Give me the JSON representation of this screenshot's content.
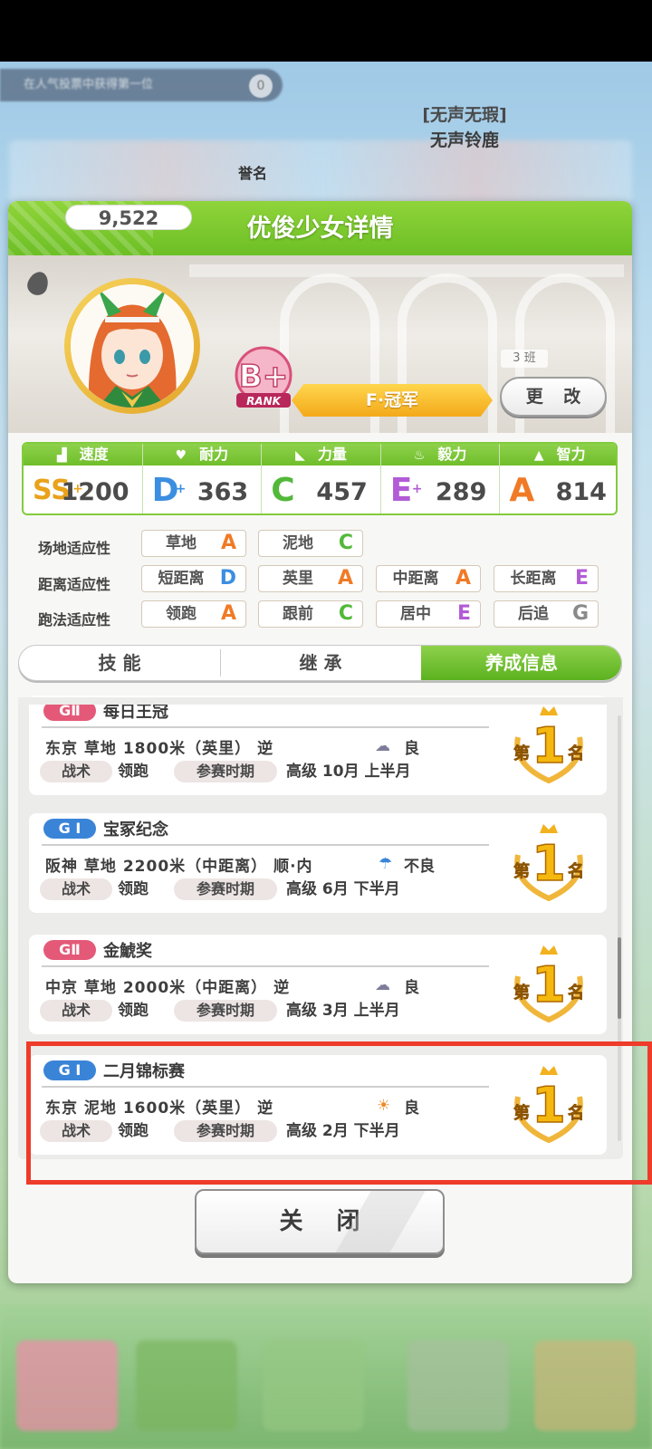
{
  "background": {
    "banner_text": "在人气投票中获得第一位",
    "banner_badge": "0"
  },
  "dialog": {
    "title": "优俊少女详情",
    "profile": {
      "score": "9,522",
      "rank_grade": "B+",
      "rank_label": "RANK",
      "rank_caption": "誉名",
      "epithet": "[无声无瑕]",
      "name": "无声铃鹿",
      "class_tag": "3 班",
      "title": "F·冠军",
      "change_button": "更 改"
    },
    "stats": [
      {
        "label": "速度",
        "icon": "shoe-icon",
        "grade": "SS",
        "grade_plus": "+",
        "value": "1200",
        "color": "#e9a21a"
      },
      {
        "label": "耐力",
        "icon": "heart-icon",
        "grade": "D",
        "grade_plus": "+",
        "value": "363",
        "color": "#3b8ee0"
      },
      {
        "label": "力量",
        "icon": "muscle-icon",
        "grade": "C",
        "grade_plus": "",
        "value": "457",
        "color": "#52b83a"
      },
      {
        "label": "毅力",
        "icon": "flame-icon",
        "grade": "E",
        "grade_plus": "+",
        "value": "289",
        "color": "#b35bd6"
      },
      {
        "label": "智力",
        "icon": "graduation-cap-icon",
        "grade": "A",
        "grade_plus": "",
        "value": "814",
        "color": "#f07a26"
      }
    ],
    "aptitude": {
      "track": {
        "label": "场地适应性",
        "items": [
          {
            "name": "草地",
            "grade": "A"
          },
          {
            "name": "泥地",
            "grade": "C"
          }
        ]
      },
      "distance": {
        "label": "距离适应性",
        "items": [
          {
            "name": "短距离",
            "grade": "D"
          },
          {
            "name": "英里",
            "grade": "A"
          },
          {
            "name": "中距离",
            "grade": "A"
          },
          {
            "name": "长距离",
            "grade": "E"
          }
        ]
      },
      "style": {
        "label": "跑法适应性",
        "items": [
          {
            "name": "领跑",
            "grade": "A"
          },
          {
            "name": "跟前",
            "grade": "C"
          },
          {
            "name": "居中",
            "grade": "E"
          },
          {
            "name": "后追",
            "grade": "G"
          }
        ]
      }
    },
    "grade_colors": {
      "A": "#f07a26",
      "C": "#52b83a",
      "D": "#3b8ee0",
      "E": "#b35bd6",
      "G": "#8a8a8a"
    },
    "tabs": [
      {
        "label": "技 能",
        "active": false
      },
      {
        "label": "继 承",
        "active": false
      },
      {
        "label": "养成信息",
        "active": true
      }
    ],
    "races": [
      {
        "grade": "GⅡ",
        "name": "每日王冠",
        "course": "东京  草地  1800米（英里） 逆",
        "weather_icon": "cloud-icon",
        "weather": "良",
        "tactic_label": "战术",
        "tactic": "领跑",
        "period_label": "参赛时期",
        "period": "高级  10月  上半月",
        "place": "第1名"
      },
      {
        "grade": "G Ⅰ",
        "name": "宝冢纪念",
        "course": "阪神  草地  2200米（中距离） 顺·内",
        "weather_icon": "umbrella-icon",
        "weather": "不良",
        "tactic_label": "战术",
        "tactic": "领跑",
        "period_label": "参赛时期",
        "period": "高级  6月  下半月",
        "place": "第1名"
      },
      {
        "grade": "GⅡ",
        "name": "金鯱奖",
        "course": "中京  草地  2000米（中距离） 逆",
        "weather_icon": "cloud-icon",
        "weather": "良",
        "tactic_label": "战术",
        "tactic": "领跑",
        "period_label": "参赛时期",
        "period": "高级  3月  上半月",
        "place": "第1名"
      },
      {
        "grade": "G Ⅰ",
        "name": "二月锦标赛",
        "course": "东京  泥地  1600米（英里） 逆",
        "weather_icon": "sun-icon",
        "weather": "良",
        "tactic_label": "战术",
        "tactic": "领跑",
        "period_label": "参赛时期",
        "period": "高级  2月  下半月",
        "place": "第1名"
      }
    ],
    "close_button": "关 闭"
  }
}
